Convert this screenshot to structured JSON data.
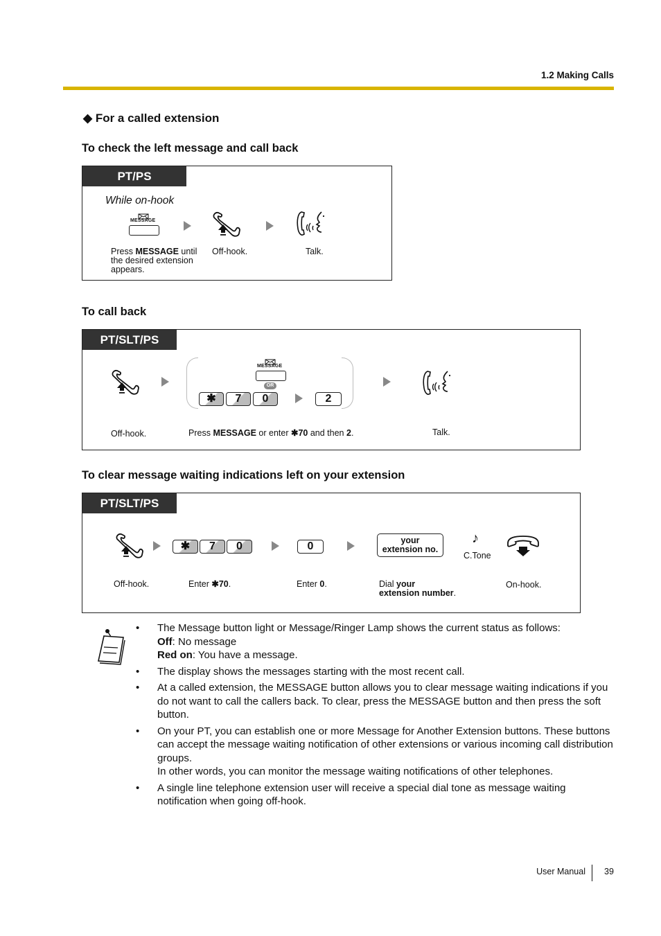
{
  "header": {
    "section": "1.2 Making Calls",
    "rule_color": "#d8b400"
  },
  "page_heading": {
    "bullet": "◆",
    "text": "For a called extension"
  },
  "procedures": [
    {
      "title": "To check the left message and call back",
      "tag": "PT/PS",
      "condition": "While on-hook",
      "steps": [
        {
          "icon": "message-button-icon",
          "button_label": "MESSAGE",
          "caption_pre": "Press ",
          "caption_bold": "MESSAGE",
          "caption_post": " until the desired extension appears."
        },
        {
          "icon": "off-hook-icon",
          "caption": "Off-hook."
        },
        {
          "icon": "talk-icon",
          "caption": "Talk."
        }
      ]
    },
    {
      "title": "To call back",
      "tag": "PT/SLT/PS",
      "steps": [
        {
          "icon": "off-hook-icon",
          "caption": "Off-hook."
        },
        {
          "icon": "message-button-icon",
          "button_label": "MESSAGE",
          "or_label": "OR",
          "keys": [
            "✱",
            "7",
            "0"
          ],
          "then_key": "2",
          "caption_parts": [
            "Press ",
            "MESSAGE",
            " or enter ",
            "✱70",
            " and then ",
            "2",
            "."
          ]
        },
        {
          "icon": "talk-icon",
          "caption": "Talk."
        }
      ]
    },
    {
      "title": "To clear message waiting indications left on your extension",
      "tag": "PT/SLT/PS",
      "steps": [
        {
          "icon": "off-hook-icon",
          "caption": "Off-hook."
        },
        {
          "keys": [
            "✱",
            "7",
            "0"
          ],
          "caption_pre": "Enter ",
          "caption_bold": "✱70",
          "caption_post": "."
        },
        {
          "keys": [
            "0"
          ],
          "caption_pre": "Enter ",
          "caption_bold": "0",
          "caption_post": "."
        },
        {
          "box_label_1": "your",
          "box_label_2": "extension no.",
          "tone_label": "C.Tone",
          "caption_pre": "Dial ",
          "caption_bold_1": "your",
          "caption_bold_2": "extension number",
          "caption_post": "."
        },
        {
          "icon": "on-hook-icon",
          "caption": "On-hook."
        }
      ]
    }
  ],
  "notes": {
    "icon": "note-pad-icon",
    "items": [
      {
        "text": "The Message button light or Message/Ringer Lamp shows the current status as follows:",
        "sub": [
          {
            "bold": "Off",
            "rest": ": No message"
          },
          {
            "bold": "Red on",
            "rest": ": You have a message."
          }
        ]
      },
      {
        "text": "The display shows the messages starting with the most recent call."
      },
      {
        "text": "At a called extension, the MESSAGE button allows you to clear message waiting indications if you do not want to call the callers back. To clear, press the MESSAGE button and then press the soft button."
      },
      {
        "text": "On your PT, you can establish one or more Message for Another Extension buttons. These buttons can accept the message waiting notification of other extensions or various incoming call distribution groups.",
        "extra": "In other words, you can monitor the message waiting notifications of other telephones."
      },
      {
        "text": "A single line telephone extension user will receive a special dial tone as message waiting notification when going off-hook."
      }
    ]
  },
  "footer": {
    "label": "User Manual",
    "page": "39"
  }
}
